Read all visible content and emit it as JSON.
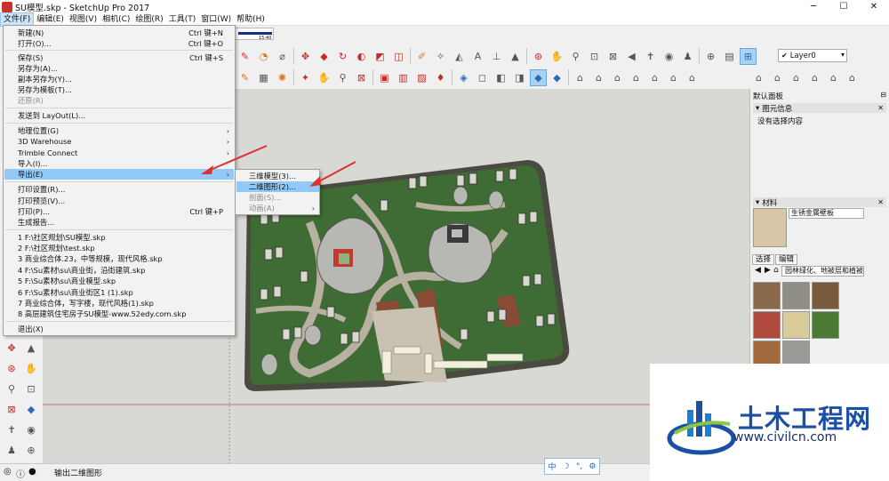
{
  "window": {
    "title": "SU模型.skp - SketchUp Pro 2017",
    "minimize": "─",
    "maximize": "☐",
    "close": "✕"
  },
  "menubar": [
    "文件(F)",
    "编辑(E)",
    "视图(V)",
    "相机(C)",
    "绘图(R)",
    "工具(T)",
    "窗口(W)",
    "帮助(H)"
  ],
  "file_menu": {
    "items": [
      {
        "label": "新建(N)",
        "shortcut": "Ctrl 键+N"
      },
      {
        "label": "打开(O)...",
        "shortcut": "Ctrl 键+O"
      },
      {
        "label": "保存(S)",
        "shortcut": "Ctrl 键+S"
      },
      {
        "label": "另存为(A)..."
      },
      {
        "label": "副本另存为(Y)..."
      },
      {
        "label": "另存为模板(T)..."
      },
      {
        "label": "还原(R)",
        "disabled": true
      },
      {
        "label": "发送到 LayOut(L)..."
      },
      {
        "label": "地理位置(G)",
        "submenu": true
      },
      {
        "label": "3D Warehouse",
        "submenu": true
      },
      {
        "label": "Trimble Connect",
        "submenu": true
      },
      {
        "label": "导入(I)..."
      },
      {
        "label": "导出(E)",
        "submenu": true,
        "highlighted": true
      },
      {
        "label": "打印设置(R)..."
      },
      {
        "label": "打印预览(V)..."
      },
      {
        "label": "打印(P)...",
        "shortcut": "Ctrl 键+P"
      },
      {
        "label": "生成报告..."
      },
      {
        "label": "1 F:\\社区规划\\SU模型.skp"
      },
      {
        "label": "2 F:\\社区规划\\test.skp"
      },
      {
        "label": "3 商业综合体.23，中等规模，现代风格.skp"
      },
      {
        "label": "4 F:\\Su素材\\su\\商业街，沿街建筑.skp"
      },
      {
        "label": "5 F:\\Su素材\\su\\商业模型.skp"
      },
      {
        "label": "6 F:\\Su素材\\su\\商业街区1 (1).skp"
      },
      {
        "label": "7 商业综合体，写字楼，现代风格(1).skp"
      },
      {
        "label": "8 高层建筑住宅房子SU模型-www.52edy.com.skp"
      },
      {
        "label": "退出(X)"
      }
    ]
  },
  "export_submenu": {
    "items": [
      {
        "label": "三维模型(3)..."
      },
      {
        "label": "二维图形(2)...",
        "highlighted": true
      },
      {
        "label": "剖面(S)...",
        "disabled": true
      },
      {
        "label": "动画(A)",
        "disabled": true,
        "submenu": true
      }
    ]
  },
  "layer": {
    "value": "Layer0"
  },
  "ruler": {
    "value": "15:40"
  },
  "right_panel": {
    "title": "默认面板",
    "entity_info": {
      "header": "图元信息",
      "message": "没有选择内容"
    },
    "materials": {
      "header": "材料",
      "name": "生锈金属壁板",
      "tabs": [
        "选择",
        "编辑"
      ],
      "library": "园林绿化、地被层和植被"
    }
  },
  "status": {
    "text": "输出二维图形"
  },
  "ime": {
    "items": [
      "中",
      "☽",
      "°,",
      "⚙"
    ]
  },
  "watermark": {
    "name": "土木工程网",
    "url": "www.civilcn.com"
  },
  "colors": {
    "menu_highlight": "#91c9f7",
    "grass": "#3f6b34",
    "path": "#b8b0a0",
    "brick": "#8a4a36",
    "brand_blue": "#1b4fa3"
  }
}
